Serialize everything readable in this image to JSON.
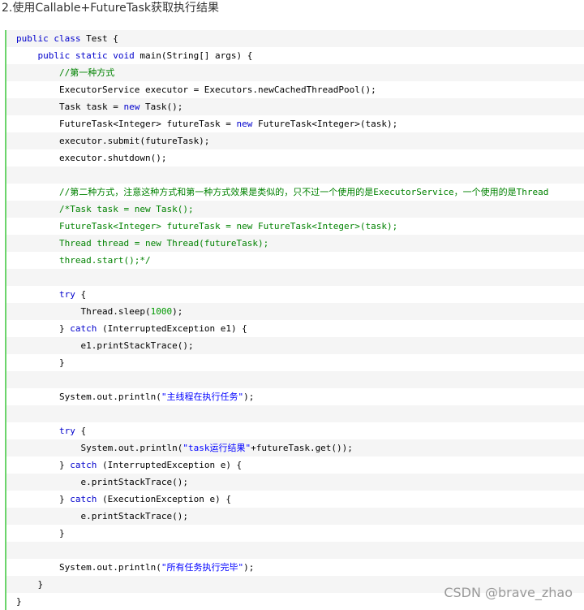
{
  "heading": "2.使用Callable+FutureTask获取执行结果",
  "watermark": "CSDN @brave_zhao",
  "code_lines": [
    {
      "indent": 0,
      "segments": [
        {
          "t": "public class",
          "c": "kw"
        },
        {
          "t": " Test {",
          "c": ""
        }
      ]
    },
    {
      "indent": 1,
      "segments": [
        {
          "t": "public static void",
          "c": "kw"
        },
        {
          "t": " main(String[] args) {",
          "c": ""
        }
      ]
    },
    {
      "indent": 2,
      "segments": [
        {
          "t": "//第一种方式",
          "c": "cm"
        }
      ]
    },
    {
      "indent": 2,
      "segments": [
        {
          "t": "ExecutorService executor = Executors.newCachedThreadPool();",
          "c": ""
        }
      ]
    },
    {
      "indent": 2,
      "segments": [
        {
          "t": "Task task = ",
          "c": ""
        },
        {
          "t": "new",
          "c": "kw"
        },
        {
          "t": " Task();",
          "c": ""
        }
      ]
    },
    {
      "indent": 2,
      "segments": [
        {
          "t": "FutureTask<Integer> futureTask = ",
          "c": ""
        },
        {
          "t": "new",
          "c": "kw"
        },
        {
          "t": " FutureTask<Integer>(task);",
          "c": ""
        }
      ]
    },
    {
      "indent": 2,
      "segments": [
        {
          "t": "executor.submit(futureTask);",
          "c": ""
        }
      ]
    },
    {
      "indent": 2,
      "segments": [
        {
          "t": "executor.shutdown();",
          "c": ""
        }
      ]
    },
    {
      "indent": 0,
      "segments": []
    },
    {
      "indent": 2,
      "segments": [
        {
          "t": "//第二种方式，注意这种方式和第一种方式效果是类似的，只不过一个使用的是ExecutorService，一个使用的是Thread",
          "c": "cm"
        }
      ]
    },
    {
      "indent": 2,
      "segments": [
        {
          "t": "/*Task task = new Task();",
          "c": "cm"
        }
      ]
    },
    {
      "indent": 2,
      "segments": [
        {
          "t": "FutureTask<Integer> futureTask = new FutureTask<Integer>(task);",
          "c": "cm"
        }
      ]
    },
    {
      "indent": 2,
      "segments": [
        {
          "t": "Thread thread = new Thread(futureTask);",
          "c": "cm"
        }
      ]
    },
    {
      "indent": 2,
      "segments": [
        {
          "t": "thread.start();*/",
          "c": "cm"
        }
      ]
    },
    {
      "indent": 0,
      "segments": []
    },
    {
      "indent": 2,
      "segments": [
        {
          "t": "try",
          "c": "kw"
        },
        {
          "t": " {",
          "c": ""
        }
      ]
    },
    {
      "indent": 3,
      "segments": [
        {
          "t": "Thread.sleep(",
          "c": ""
        },
        {
          "t": "1000",
          "c": "nm"
        },
        {
          "t": ");",
          "c": ""
        }
      ]
    },
    {
      "indent": 2,
      "segments": [
        {
          "t": "} ",
          "c": ""
        },
        {
          "t": "catch",
          "c": "kw"
        },
        {
          "t": " (InterruptedException e1) {",
          "c": ""
        }
      ]
    },
    {
      "indent": 3,
      "segments": [
        {
          "t": "e1.printStackTrace();",
          "c": ""
        }
      ]
    },
    {
      "indent": 2,
      "segments": [
        {
          "t": "}",
          "c": ""
        }
      ]
    },
    {
      "indent": 0,
      "segments": []
    },
    {
      "indent": 2,
      "segments": [
        {
          "t": "System.out.println(",
          "c": ""
        },
        {
          "t": "\"主线程在执行任务\"",
          "c": "st"
        },
        {
          "t": ");",
          "c": ""
        }
      ]
    },
    {
      "indent": 0,
      "segments": []
    },
    {
      "indent": 2,
      "segments": [
        {
          "t": "try",
          "c": "kw"
        },
        {
          "t": " {",
          "c": ""
        }
      ]
    },
    {
      "indent": 3,
      "segments": [
        {
          "t": "System.out.println(",
          "c": ""
        },
        {
          "t": "\"task运行结果\"",
          "c": "st"
        },
        {
          "t": "+futureTask.get());",
          "c": ""
        }
      ]
    },
    {
      "indent": 2,
      "segments": [
        {
          "t": "} ",
          "c": ""
        },
        {
          "t": "catch",
          "c": "kw"
        },
        {
          "t": " (InterruptedException e) {",
          "c": ""
        }
      ]
    },
    {
      "indent": 3,
      "segments": [
        {
          "t": "e.printStackTrace();",
          "c": ""
        }
      ]
    },
    {
      "indent": 2,
      "segments": [
        {
          "t": "} ",
          "c": ""
        },
        {
          "t": "catch",
          "c": "kw"
        },
        {
          "t": " (ExecutionException e) {",
          "c": ""
        }
      ]
    },
    {
      "indent": 3,
      "segments": [
        {
          "t": "e.printStackTrace();",
          "c": ""
        }
      ]
    },
    {
      "indent": 2,
      "segments": [
        {
          "t": "}",
          "c": ""
        }
      ]
    },
    {
      "indent": 0,
      "segments": []
    },
    {
      "indent": 2,
      "segments": [
        {
          "t": "System.out.println(",
          "c": ""
        },
        {
          "t": "\"所有任务执行完毕\"",
          "c": "st"
        },
        {
          "t": ");",
          "c": ""
        }
      ]
    },
    {
      "indent": 1,
      "segments": [
        {
          "t": "}",
          "c": ""
        }
      ]
    },
    {
      "indent": 0,
      "segments": [
        {
          "t": "}",
          "c": ""
        }
      ]
    }
  ]
}
